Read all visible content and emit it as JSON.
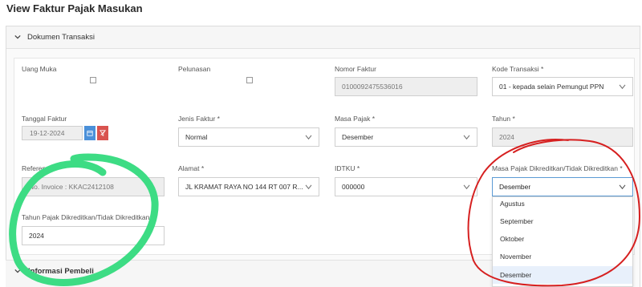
{
  "page": {
    "title": "View Faktur Pajak Masukan"
  },
  "section_dokumen": {
    "title": "Dokumen Transaksi"
  },
  "fields": {
    "uang_muka": {
      "label": "Uang Muka"
    },
    "pelunasan": {
      "label": "Pelunasan"
    },
    "nomor_faktur": {
      "label": "Nomor Faktur",
      "value": "0100092475536016"
    },
    "kode_transaksi": {
      "label": "Kode Transaksi *",
      "value": "01 - kepada selain Pemungut PPN"
    },
    "tanggal_faktur": {
      "label": "Tanggal Faktur",
      "value": "19-12-2024"
    },
    "jenis_faktur": {
      "label": "Jenis Faktur *",
      "value": "Normal"
    },
    "masa_pajak": {
      "label": "Masa Pajak *",
      "value": "Desember"
    },
    "tahun": {
      "label": "Tahun *",
      "value": "2024"
    },
    "referensi": {
      "label": "Referensi",
      "value": "No. Invoice : KKAC2412108"
    },
    "alamat": {
      "label": "Alamat *",
      "value": "JL KRAMAT RAYA NO 144 RT 007 R..."
    },
    "idtku": {
      "label": "IDTKU *",
      "value": "000000"
    },
    "masa_pajak_dikreditkan": {
      "label": "Masa Pajak Dikreditkan/Tidak Dikreditkan *",
      "value": "Desember"
    },
    "tahun_pajak_dikreditkan": {
      "label": "Tahun Pajak Dikreditkan/Tidak Dikreditkan *",
      "value": "2024"
    }
  },
  "dropdown": {
    "options": [
      "Agustus",
      "September",
      "Oktober",
      "November",
      "Desember"
    ],
    "selected": "Desember"
  },
  "section_informasi": {
    "title": "Informasi Pembeli"
  },
  "colors": {
    "date_calendar_btn": "#4a90d9",
    "date_clear_btn": "#d9534f",
    "annotation_green": "#3ddc84",
    "annotation_red": "#d62020"
  },
  "icons": [
    "chevron-down-icon",
    "calendar-icon",
    "clear-filter-icon"
  ]
}
